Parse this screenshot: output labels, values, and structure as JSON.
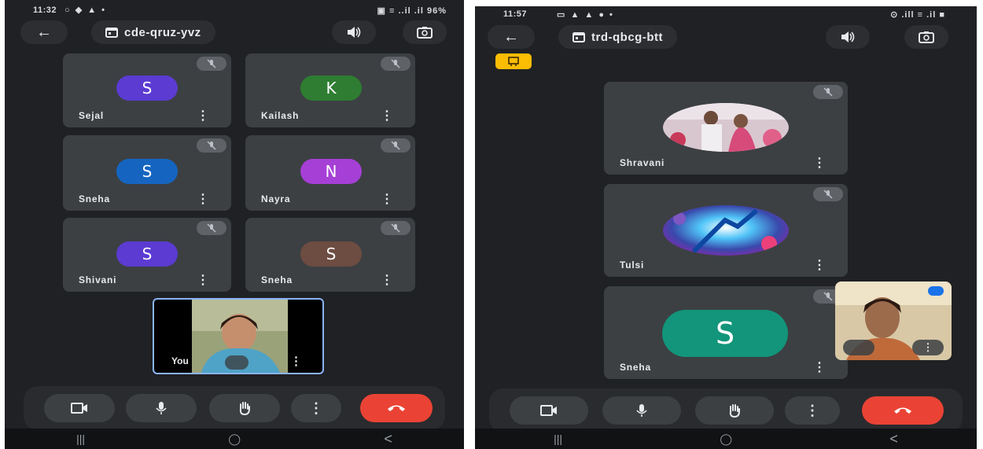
{
  "left": {
    "status": {
      "time": "11:32",
      "left_icons": "○ ◆ ▲ •",
      "right": "▣ ≡ ..il .il 96%"
    },
    "meeting_code": "cde-qruz-yvz",
    "participants": [
      {
        "name": "Sejal",
        "initial": "S",
        "color": "#5b3bd1"
      },
      {
        "name": "Kailash",
        "initial": "K",
        "color": "#2e7d32"
      },
      {
        "name": "Sneha",
        "initial": "S",
        "color": "#1565c0"
      },
      {
        "name": "Nayra",
        "initial": "N",
        "color": "#a63fd6"
      },
      {
        "name": "Shivani",
        "initial": "S",
        "color": "#5b3bd1"
      },
      {
        "name": "Sneha",
        "initial": "S",
        "color": "#6d4c41"
      }
    ],
    "self_label": "You"
  },
  "right": {
    "status": {
      "time": "11:57",
      "left_icons": "▭ ▲ ▲ ● •",
      "right": "⊙ .ill ≡ .il ■"
    },
    "meeting_code": "trd-qbcg-btt",
    "participants": [
      {
        "name": "Shravani",
        "kind": "photo"
      },
      {
        "name": "Tulsi",
        "kind": "photo"
      },
      {
        "name": "Sneha",
        "initial": "S",
        "color": "#12957a"
      }
    ]
  },
  "icons": {
    "back": "←",
    "calendar": "▣",
    "speaker": "◀)",
    "flip": "↻",
    "more": "⋮",
    "nav_recent": "|||",
    "nav_home": "◯",
    "nav_back": "<"
  },
  "colors": {
    "background": "#202124",
    "tile": "#3c4043",
    "end_call": "#ea4335",
    "accent": "#fbbc04"
  }
}
